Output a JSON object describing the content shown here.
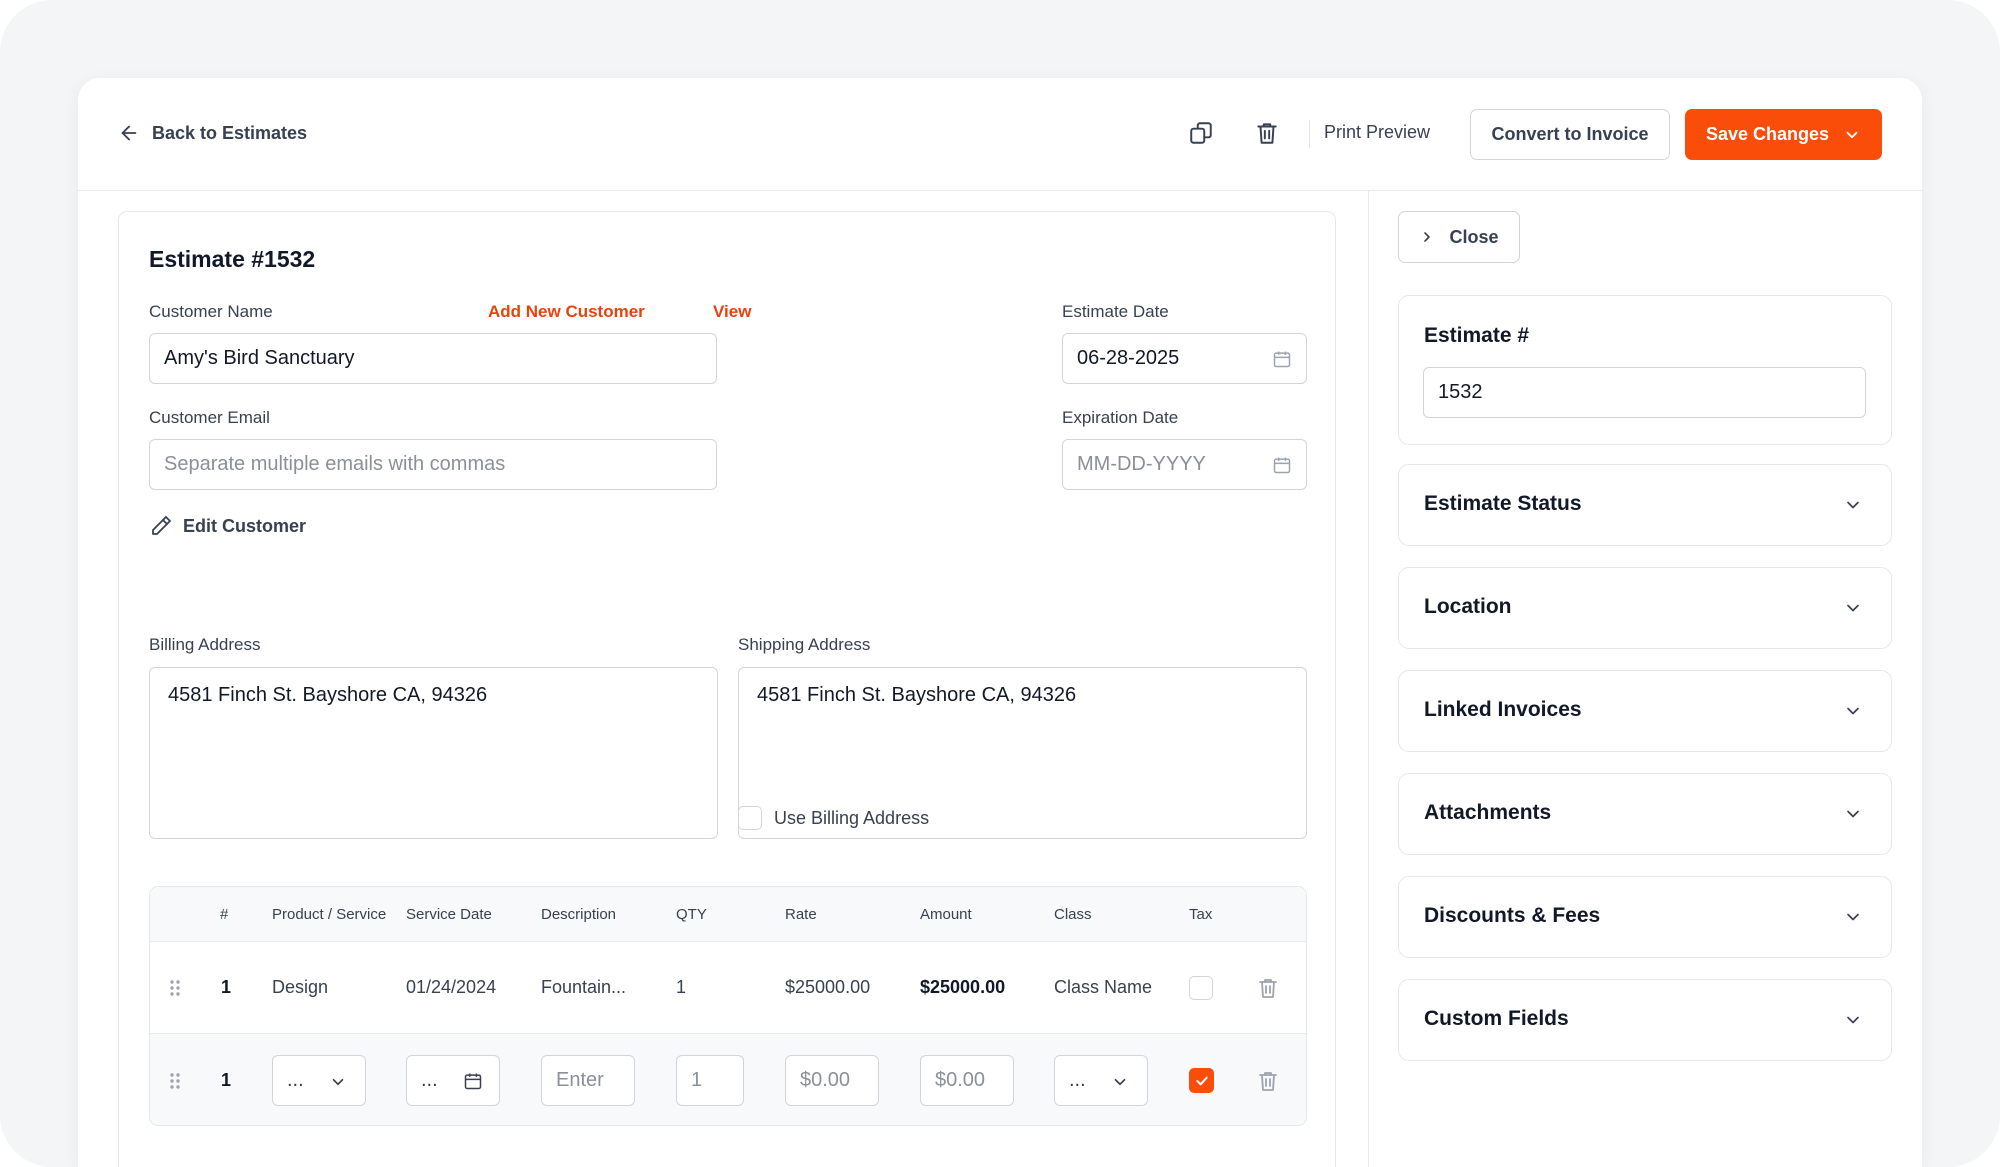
{
  "header": {
    "back_label": "Back to Estimates",
    "print_preview": "Print Preview",
    "convert_label": "Convert to Invoice",
    "save_label": "Save Changes"
  },
  "form": {
    "title": "Estimate #1532",
    "customer_name_label": "Customer Name",
    "add_new_customer": "Add New Customer",
    "view_link": "View",
    "customer_name_value": "Amy's Bird Sanctuary",
    "customer_email_label": "Customer Email",
    "customer_email_placeholder": "Separate multiple emails with commas",
    "edit_customer": "Edit Customer",
    "estimate_date_label": "Estimate Date",
    "estimate_date_value": "06-28-2025",
    "expiration_date_label": "Expiration Date",
    "expiration_date_placeholder": "MM-DD-YYYY",
    "billing_label": "Billing Address",
    "billing_value": "4581 Finch St. Bayshore CA, 94326",
    "shipping_label": "Shipping Address",
    "shipping_value": "4581 Finch St. Bayshore CA, 94326",
    "use_billing": "Use Billing Address"
  },
  "table": {
    "headers": [
      "#",
      "Product / Service",
      "Service Date",
      "Description",
      "QTY",
      "Rate",
      "Amount",
      "Class",
      "Tax"
    ],
    "row1": {
      "num": "1",
      "product": "Design",
      "service_date": "01/24/2024",
      "description": "Fountain...",
      "qty": "1",
      "rate": "$25000.00",
      "amount": "$25000.00",
      "class": "Class Name"
    },
    "row2": {
      "num": "1",
      "product": "...",
      "service_date": "...",
      "description_placeholder": "Enter",
      "qty": "1",
      "rate": "$0.00",
      "amount": "$0.00",
      "class": "..."
    }
  },
  "sidebar": {
    "close_label": "Close",
    "estimate_number_label": "Estimate #",
    "estimate_number_value": "1532",
    "sections": [
      "Estimate Status",
      "Location",
      "Linked Invoices",
      "Attachments",
      "Discounts & Fees",
      "Custom Fields"
    ]
  },
  "colors": {
    "accent": "#fb4d0a",
    "link": "#e8430c"
  }
}
